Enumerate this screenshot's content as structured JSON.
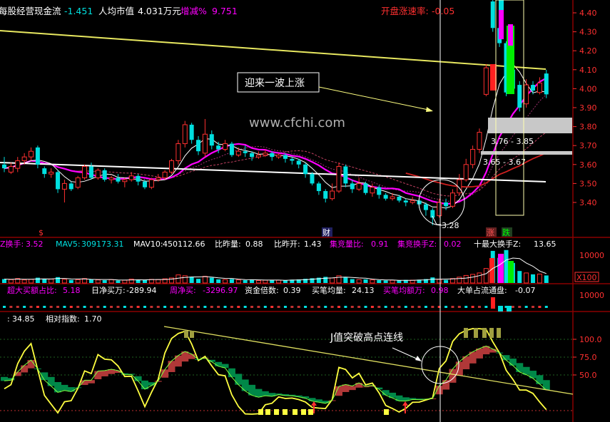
{
  "colors": {
    "bg": "#000000",
    "up": "#ff3030",
    "down": "#00e0e0",
    "yellow": "#ffff00",
    "white": "#ffffff",
    "magenta": "#ff00ff",
    "gray": "#c0c0c0",
    "divider": "#8b0000",
    "green": "#00c000",
    "darkred": "#c03030",
    "kdjgreen": "#008040"
  },
  "top_header": {
    "item1_label": "每股经营现金流",
    "item1_value": "-1.451",
    "item2_label": "人均市值",
    "item2_value": "4.031万元",
    "item3_label": "增减%",
    "item3_value": "9.751",
    "item4_label": "开盘涨速率:",
    "item4_value": "-0.05"
  },
  "annotations": {
    "rise": "迎来一波上涨",
    "watermark": "www.cfchi.com",
    "range1": "3.76 - 3.85",
    "range2": "3.65 - 3.67",
    "low_price": "3.28",
    "marker_s": "$",
    "marker_cai": "财",
    "marker_zhang": "涨",
    "marker_die": "跌",
    "jbreak": "J值突破高点连线"
  },
  "volume_header": {
    "a_label": "Z换手:",
    "a_value": "3.52",
    "b_label": "MAV5:",
    "b_value": "309173.31",
    "c_label": "MAV10:",
    "c_value": "450112.66",
    "d_label": "比昨量:",
    "d_value": "0.88",
    "e_label": "比昨开:",
    "e_value": "1.43",
    "f_label": "集竞量比:",
    "f_value": "0.91",
    "g_label": "集竞换手Z:",
    "g_value": "0.02",
    "h_label": "十最大换手Z:",
    "h_value": "13.65"
  },
  "volume_axis": {
    "top": "10000",
    "scale": "X100"
  },
  "fund_header": {
    "a_label": "超大买额占比:",
    "a_value": "5.18",
    "b_label": "日净买万:",
    "b_value": "-289.94",
    "c_label": "周净买:",
    "c_value": "-3296.97",
    "d_label": "资金倍数:",
    "d_value": "0.39",
    "e_label": "买笔均量:",
    "e_value": "24.13",
    "f_label": "买笔均额万:",
    "f_value": "0.98",
    "g_label": "大单占流通盘:",
    "g_value": "-0.07"
  },
  "fund_axis": {
    "top": "10000"
  },
  "kdj_header": {
    "a_label": ":",
    "a_value": "34.85",
    "b_label": "相对指数:",
    "b_value": "1.70"
  },
  "chart_data": [
    {
      "type": "candlestick",
      "title": "",
      "ylim": [
        3.3,
        4.45
      ],
      "y_ticks": [
        "4.40",
        "4.30",
        "4.20",
        "4.10",
        "4.00",
        "3.90",
        "3.80",
        "3.70",
        "3.60",
        "3.50",
        "3.40"
      ],
      "candles": [
        {
          "o": 3.6,
          "c": 3.58,
          "h": 3.64,
          "l": 3.56
        },
        {
          "o": 3.56,
          "c": 3.59,
          "h": 3.61,
          "l": 3.55
        },
        {
          "o": 3.58,
          "c": 3.62,
          "h": 3.64,
          "l": 3.56
        },
        {
          "o": 3.62,
          "c": 3.64,
          "h": 3.66,
          "l": 3.6
        },
        {
          "o": 3.64,
          "c": 3.67,
          "h": 3.69,
          "l": 3.62
        },
        {
          "o": 3.69,
          "c": 3.6,
          "h": 3.7,
          "l": 3.58
        },
        {
          "o": 3.58,
          "c": 3.55,
          "h": 3.59,
          "l": 3.53
        },
        {
          "o": 3.55,
          "c": 3.56,
          "h": 3.58,
          "l": 3.53
        },
        {
          "o": 3.56,
          "c": 3.47,
          "h": 3.57,
          "l": 3.45
        },
        {
          "o": 3.47,
          "c": 3.5,
          "h": 3.52,
          "l": 3.4
        },
        {
          "o": 3.5,
          "c": 3.47,
          "h": 3.51,
          "l": 3.46
        },
        {
          "o": 3.48,
          "c": 3.53,
          "h": 3.54,
          "l": 3.47
        },
        {
          "o": 3.53,
          "c": 3.59,
          "h": 3.6,
          "l": 3.52
        },
        {
          "o": 3.59,
          "c": 3.53,
          "h": 3.61,
          "l": 3.52
        },
        {
          "o": 3.53,
          "c": 3.57,
          "h": 3.58,
          "l": 3.52
        },
        {
          "o": 3.57,
          "c": 3.52,
          "h": 3.58,
          "l": 3.51
        },
        {
          "o": 3.52,
          "c": 3.53,
          "h": 3.54,
          "l": 3.5
        },
        {
          "o": 3.53,
          "c": 3.51,
          "h": 3.55,
          "l": 3.5
        },
        {
          "o": 3.51,
          "c": 3.52,
          "h": 3.53,
          "l": 3.48
        },
        {
          "o": 3.52,
          "c": 3.54,
          "h": 3.56,
          "l": 3.51
        },
        {
          "o": 3.54,
          "c": 3.51,
          "h": 3.55,
          "l": 3.49
        },
        {
          "o": 3.51,
          "c": 3.48,
          "h": 3.52,
          "l": 3.47
        },
        {
          "o": 3.48,
          "c": 3.52,
          "h": 3.53,
          "l": 3.47
        },
        {
          "o": 3.52,
          "c": 3.53,
          "h": 3.55,
          "l": 3.51
        },
        {
          "o": 3.53,
          "c": 3.56,
          "h": 3.57,
          "l": 3.52
        },
        {
          "o": 3.56,
          "c": 3.62,
          "h": 3.63,
          "l": 3.55
        },
        {
          "o": 3.62,
          "c": 3.71,
          "h": 3.73,
          "l": 3.6
        },
        {
          "o": 3.71,
          "c": 3.81,
          "h": 3.83,
          "l": 3.69
        },
        {
          "o": 3.81,
          "c": 3.73,
          "h": 3.82,
          "l": 3.71
        },
        {
          "o": 3.73,
          "c": 3.67,
          "h": 3.75,
          "l": 3.65
        },
        {
          "o": 3.66,
          "c": 3.76,
          "h": 3.84,
          "l": 3.64
        },
        {
          "o": 3.76,
          "c": 3.7,
          "h": 3.78,
          "l": 3.68
        },
        {
          "o": 3.7,
          "c": 3.68,
          "h": 3.72,
          "l": 3.66
        },
        {
          "o": 3.68,
          "c": 3.71,
          "h": 3.73,
          "l": 3.67
        },
        {
          "o": 3.71,
          "c": 3.65,
          "h": 3.72,
          "l": 3.64
        },
        {
          "o": 3.65,
          "c": 3.67,
          "h": 3.69,
          "l": 3.64
        },
        {
          "o": 3.67,
          "c": 3.66,
          "h": 3.7,
          "l": 3.64
        },
        {
          "o": 3.66,
          "c": 3.64,
          "h": 3.67,
          "l": 3.62
        },
        {
          "o": 3.64,
          "c": 3.65,
          "h": 3.67,
          "l": 3.63
        },
        {
          "o": 3.65,
          "c": 3.66,
          "h": 3.68,
          "l": 3.64
        },
        {
          "o": 3.66,
          "c": 3.64,
          "h": 3.67,
          "l": 3.62
        },
        {
          "o": 3.64,
          "c": 3.65,
          "h": 3.66,
          "l": 3.63
        },
        {
          "o": 3.65,
          "c": 3.63,
          "h": 3.66,
          "l": 3.61
        },
        {
          "o": 3.63,
          "c": 3.62,
          "h": 3.64,
          "l": 3.6
        },
        {
          "o": 3.62,
          "c": 3.6,
          "h": 3.63,
          "l": 3.58
        },
        {
          "o": 3.6,
          "c": 3.55,
          "h": 3.61,
          "l": 3.53
        },
        {
          "o": 3.55,
          "c": 3.5,
          "h": 3.56,
          "l": 3.49
        },
        {
          "o": 3.5,
          "c": 3.46,
          "h": 3.51,
          "l": 3.44
        },
        {
          "o": 3.46,
          "c": 3.42,
          "h": 3.47,
          "l": 3.4
        },
        {
          "o": 3.42,
          "c": 3.46,
          "h": 3.5,
          "l": 3.41
        },
        {
          "o": 3.46,
          "c": 3.59,
          "h": 3.61,
          "l": 3.45
        },
        {
          "o": 3.59,
          "c": 3.5,
          "h": 3.6,
          "l": 3.48
        },
        {
          "o": 3.5,
          "c": 3.47,
          "h": 3.52,
          "l": 3.45
        },
        {
          "o": 3.47,
          "c": 3.5,
          "h": 3.53,
          "l": 3.46
        },
        {
          "o": 3.5,
          "c": 3.45,
          "h": 3.51,
          "l": 3.44
        },
        {
          "o": 3.45,
          "c": 3.48,
          "h": 3.5,
          "l": 3.43
        },
        {
          "o": 3.48,
          "c": 3.44,
          "h": 3.49,
          "l": 3.42
        },
        {
          "o": 3.44,
          "c": 3.42,
          "h": 3.45,
          "l": 3.41
        },
        {
          "o": 3.42,
          "c": 3.43,
          "h": 3.45,
          "l": 3.41
        },
        {
          "o": 3.43,
          "c": 3.41,
          "h": 3.44,
          "l": 3.4
        },
        {
          "o": 3.41,
          "c": 3.4,
          "h": 3.42,
          "l": 3.38
        },
        {
          "o": 3.4,
          "c": 3.41,
          "h": 3.43,
          "l": 3.39
        },
        {
          "o": 3.41,
          "c": 3.39,
          "h": 3.42,
          "l": 3.37
        },
        {
          "o": 3.39,
          "c": 3.36,
          "h": 3.4,
          "l": 3.33
        },
        {
          "o": 3.36,
          "c": 3.32,
          "h": 3.37,
          "l": 3.28
        },
        {
          "o": 3.33,
          "c": 3.4,
          "h": 3.42,
          "l": 3.32
        },
        {
          "o": 3.4,
          "c": 3.38,
          "h": 3.42,
          "l": 3.36
        },
        {
          "o": 3.38,
          "c": 3.45,
          "h": 3.47,
          "l": 3.37
        },
        {
          "o": 3.45,
          "c": 3.52,
          "h": 3.55,
          "l": 3.44
        },
        {
          "o": 3.52,
          "c": 3.6,
          "h": 3.63,
          "l": 3.51
        },
        {
          "o": 3.6,
          "c": 3.68,
          "h": 3.7,
          "l": 3.58
        },
        {
          "o": 3.68,
          "c": 3.77,
          "h": 3.79,
          "l": 3.66
        },
        {
          "o": 3.97,
          "c": 4.11,
          "h": 4.13,
          "l": 3.96
        },
        {
          "o": 4.46,
          "c": 4.32,
          "h": 4.6,
          "l": 4.3
        },
        {
          "o": 4.32,
          "c": 4.24,
          "h": 4.33,
          "l": 4.22
        },
        {
          "o": 4.24,
          "c": 3.98,
          "h": 4.25,
          "l": 3.96
        },
        {
          "o": 4.1,
          "c": 4.0,
          "h": 4.12,
          "l": 3.98
        },
        {
          "o": 4.02,
          "c": 3.9,
          "h": 4.04,
          "l": 3.88
        },
        {
          "o": 3.92,
          "c": 4.02,
          "h": 4.05,
          "l": 3.9
        },
        {
          "o": 4.02,
          "c": 3.99,
          "h": 4.04,
          "l": 3.97
        },
        {
          "o": 3.98,
          "c": 4.03,
          "h": 4.06,
          "l": 3.97
        },
        {
          "o": 4.08,
          "c": 3.97,
          "h": 4.1,
          "l": 3.95
        }
      ]
    },
    {
      "type": "bar",
      "title": "",
      "ylim": [
        0,
        12000
      ],
      "values": [
        1400,
        1200,
        1600,
        1100,
        1300,
        1900,
        1500,
        1400,
        2100,
        1300,
        1100,
        1200,
        1600,
        1300,
        1100,
        1000,
        1200,
        900,
        1000,
        1400,
        1200,
        1100,
        1300,
        1200,
        1500,
        1800,
        2900,
        2600,
        2100,
        1500,
        2400,
        1900,
        1300,
        1200,
        1400,
        1100,
        1000,
        1200,
        900,
        1000,
        1100,
        1000,
        900,
        1200,
        1300,
        1500,
        1700,
        1900,
        2200,
        1800,
        2600,
        2000,
        1400,
        1200,
        1300,
        1100,
        1000,
        900,
        1000,
        900,
        1100,
        1000,
        1200,
        1400,
        2000,
        1300,
        1100,
        1600,
        2100,
        2700,
        3100,
        3600,
        5200,
        11500,
        9000,
        11800,
        7200,
        4300,
        3600,
        3100,
        3200,
        2700
      ]
    }
  ]
}
